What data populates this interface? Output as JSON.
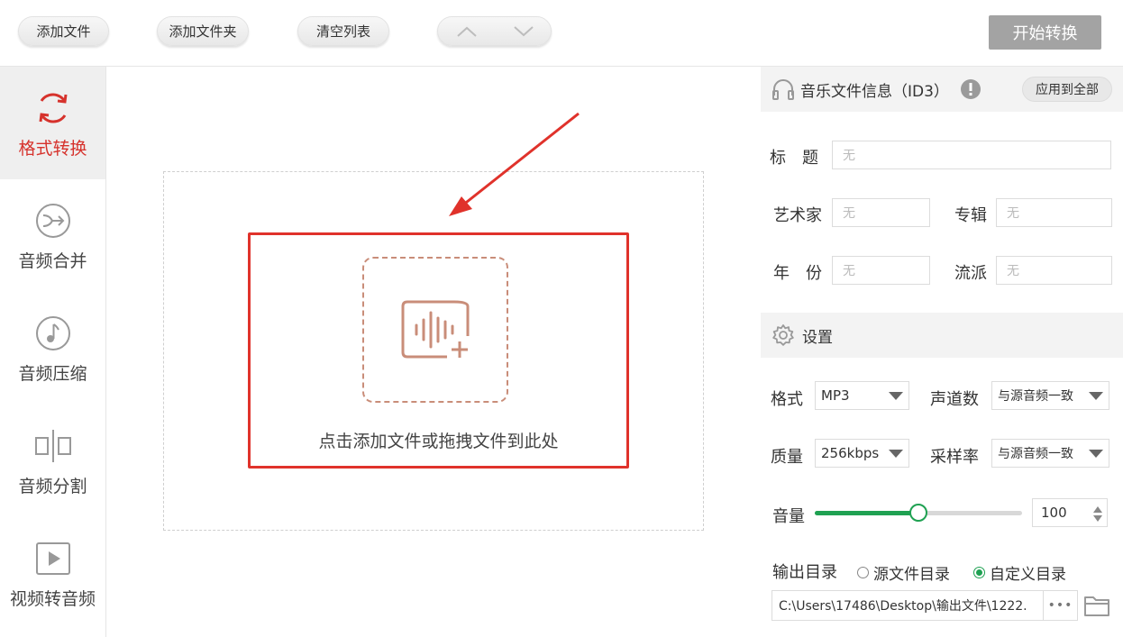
{
  "toolbar": {
    "add_file": "添加文件",
    "add_folder": "添加文件夹",
    "clear_list": "清空列表",
    "start": "开始转换"
  },
  "sidebar": {
    "items": [
      {
        "label": "格式转换",
        "icon": "refresh-icon",
        "active": true
      },
      {
        "label": "音频合并",
        "icon": "merge-icon"
      },
      {
        "label": "音频压缩",
        "icon": "music-note-icon"
      },
      {
        "label": "音频分割",
        "icon": "split-icon"
      },
      {
        "label": "视频转音频",
        "icon": "play-icon"
      }
    ]
  },
  "dropzone": {
    "text": "点击添加文件或拖拽文件到此处",
    "icon": "audio-add-icon"
  },
  "id3": {
    "title": "音乐文件信息（ID3）",
    "apply_all": "应用到全部",
    "fields": {
      "title_label": "标　题",
      "title_value": "无",
      "artist_label": "艺术家",
      "artist_value": "无",
      "album_label": "专辑",
      "album_value": "无",
      "year_label": "年　份",
      "year_value": "无",
      "genre_label": "流派",
      "genre_value": "无"
    }
  },
  "settings": {
    "title": "设置",
    "format_label": "格式",
    "format_value": "MP3",
    "channels_label": "声道数",
    "channels_value": "与源音频一致",
    "quality_label": "质量",
    "quality_value": "256kbps",
    "samplerate_label": "采样率",
    "samplerate_value": "与源音频一致",
    "volume_label": "音量",
    "volume_value": "100",
    "volume_level": 0.5,
    "output_label": "输出目录",
    "output_option_source": "源文件目录",
    "output_option_custom": "自定义目录",
    "output_selected": "custom",
    "output_path": "C:\\Users\\17486\\Desktop\\输出文件\\1222.",
    "browse_label": "•••"
  },
  "colors": {
    "accent_red": "#d6322c",
    "accent_green": "#1fa152",
    "start_button": "#a3a3a3"
  }
}
